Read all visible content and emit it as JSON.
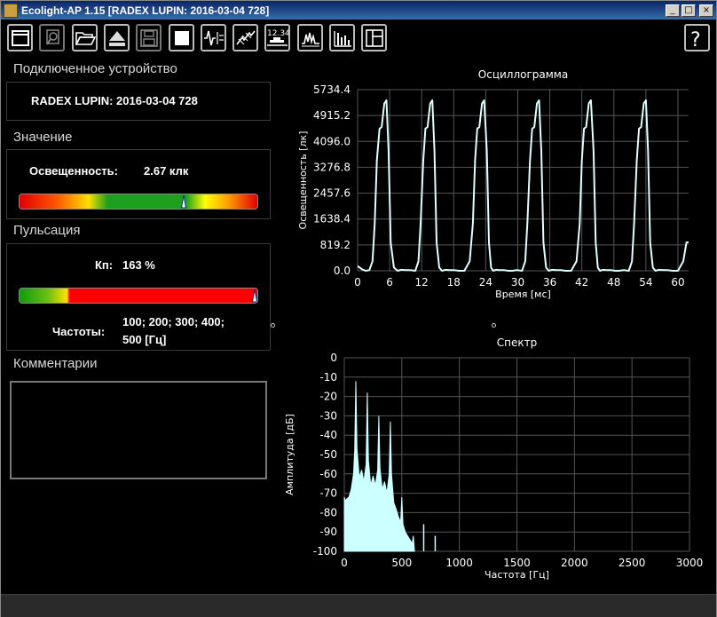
{
  "window": {
    "title": "Ecolight-AP 1.15 [RADEX LUPIN: 2016-03-04 728]",
    "controls": {
      "minimize": "_",
      "maximize": "□",
      "close": "×"
    }
  },
  "toolbar": {
    "buttons": [
      {
        "icon": "window-icon",
        "enabled": true
      },
      {
        "icon": "magnifier-icon",
        "enabled": false
      },
      {
        "icon": "folder-open-icon",
        "enabled": true
      },
      {
        "icon": "eject-icon",
        "enabled": true
      },
      {
        "icon": "save-icon",
        "enabled": false
      },
      {
        "icon": "stop-icon",
        "enabled": true
      },
      {
        "icon": "waveform-icon",
        "enabled": true
      },
      {
        "icon": "zigzag-ruler-icon",
        "enabled": true
      },
      {
        "icon": "numeric-display-icon",
        "text": "12.34",
        "enabled": true
      },
      {
        "icon": "oscilloscope-icon",
        "enabled": true
      },
      {
        "icon": "spectrum-bars-icon",
        "enabled": true
      },
      {
        "icon": "layout-panels-icon",
        "enabled": true
      },
      {
        "icon": "help-icon",
        "text": "?",
        "enabled": true
      }
    ]
  },
  "device": {
    "section_title": "Подключенное устройство",
    "name": "RADEX LUPIN:  2016-03-04 728"
  },
  "value": {
    "section_title": "Значение",
    "label": "Освещенность:",
    "reading": "2.67 клк",
    "marker_fraction": 0.69
  },
  "pulsation": {
    "section_title": "Пульсация",
    "kp_label": "Кп:",
    "kp_value": "163 %",
    "marker_fraction": 1.0,
    "freq_label": "Частоты:",
    "freq_line1": "100; 200; 300; 400;",
    "freq_line2": "500 [Гц]"
  },
  "comments": {
    "section_title": "Комментарии",
    "text": ""
  },
  "chart_data": [
    {
      "type": "line",
      "title": "Осциллограмма",
      "xlabel": "Время [мс]",
      "ylabel": "Освещенность [лк]",
      "xlim": [
        0,
        62
      ],
      "ylim": [
        0,
        5734.4
      ],
      "xticks": [
        "0",
        "6",
        "12",
        "18",
        "24",
        "30",
        "36",
        "42",
        "48",
        "54",
        "60"
      ],
      "yticks": [
        "0.0",
        "819.2",
        "1638.4",
        "2457.6",
        "3276.8",
        "4096.0",
        "4915.2",
        "5734.4"
      ],
      "grid": true,
      "color": "#e0ffff",
      "series": [
        {
          "x": [
            0,
            0.8,
            1.5,
            2.2,
            2.8,
            3.2,
            3.6,
            4.1,
            4.5,
            5.0,
            5.4,
            5.8,
            6.2,
            6.8,
            7.5,
            8.2,
            9.0,
            9.8,
            10.8,
            11.4,
            11.8,
            12.3,
            12.7,
            13.1,
            13.6,
            14.0,
            14.4,
            14.8,
            15.3,
            15.8,
            16.4,
            17.2,
            18.0,
            19.0,
            20.0,
            21.0,
            21.6,
            22.0,
            22.4,
            22.8,
            23.3,
            23.7,
            24.2,
            24.6,
            25.0,
            25.4,
            25.9,
            26.6,
            27.4,
            28.2,
            29.0,
            29.8,
            30.8,
            31.4,
            31.8,
            32.3,
            32.7,
            33.1,
            33.6,
            34.0,
            34.4,
            34.8,
            35.3,
            35.8,
            36.4,
            37.2,
            38.0,
            39.0,
            40.0,
            41.0,
            41.6,
            42.0,
            42.4,
            42.8,
            43.3,
            43.7,
            44.2,
            44.6,
            45.0,
            45.4,
            45.9,
            46.6,
            47.4,
            48.2,
            49.0,
            49.8,
            50.8,
            51.4,
            51.8,
            52.3,
            52.7,
            53.1,
            53.6,
            54.0,
            54.4,
            54.8,
            55.3,
            55.8,
            56.4,
            57.2,
            58.0,
            59.0,
            60.0,
            61.0,
            61.6,
            62.0
          ],
          "y": [
            150,
            50,
            0,
            20,
            300,
            1500,
            3500,
            4500,
            4550,
            5300,
            5400,
            3800,
            900,
            100,
            0,
            30,
            20,
            20,
            0,
            300,
            1500,
            3500,
            4500,
            4550,
            5300,
            5400,
            3800,
            900,
            100,
            0,
            30,
            20,
            20,
            0,
            0,
            300,
            1500,
            3500,
            4500,
            4550,
            5300,
            5400,
            3800,
            900,
            100,
            0,
            30,
            20,
            20,
            0,
            0,
            20,
            0,
            300,
            1500,
            3500,
            4500,
            4550,
            5300,
            5400,
            3800,
            900,
            100,
            0,
            30,
            20,
            20,
            0,
            0,
            300,
            1500,
            3500,
            4500,
            4550,
            5300,
            5400,
            3800,
            900,
            100,
            0,
            30,
            20,
            20,
            0,
            0,
            20,
            0,
            300,
            1500,
            3500,
            4500,
            4550,
            5300,
            5400,
            3800,
            900,
            100,
            0,
            30,
            20,
            20,
            0,
            0,
            300,
            900,
            900
          ]
        }
      ]
    },
    {
      "type": "area",
      "title": "Спектр",
      "xlabel": "Частота [Гц]",
      "ylabel": "Амплитуда [дБ]",
      "xlim": [
        0,
        3000
      ],
      "ylim": [
        -100,
        0
      ],
      "xticks": [
        "0",
        "500",
        "1000",
        "1500",
        "2000",
        "2500",
        "3000"
      ],
      "yticks": [
        "0",
        "-10",
        "-20",
        "-30",
        "-40",
        "-50",
        "-60",
        "-70",
        "-80",
        "-90",
        "-100"
      ],
      "grid": true,
      "color": "#ccffff",
      "series": [
        {
          "x": [
            0,
            10,
            20,
            40,
            60,
            80,
            90,
            100,
            110,
            130,
            150,
            170,
            190,
            200,
            210,
            230,
            250,
            270,
            290,
            300,
            310,
            330,
            350,
            370,
            390,
            400,
            410,
            430,
            450,
            470,
            490,
            500,
            510,
            530,
            550,
            570,
            590,
            600,
            610
          ],
          "y": [
            -72,
            -74,
            -73,
            -72,
            -68,
            -60,
            -48,
            -12,
            -47,
            -62,
            -58,
            -64,
            -55,
            -18,
            -53,
            -66,
            -61,
            -66,
            -58,
            -30,
            -57,
            -68,
            -64,
            -70,
            -60,
            -33,
            -60,
            -75,
            -78,
            -82,
            -85,
            -72,
            -86,
            -90,
            -92,
            -94,
            -96,
            -92,
            -100
          ]
        }
      ],
      "lines": [
        {
          "x": 690,
          "y": -86
        },
        {
          "x": 790,
          "y": -92
        }
      ]
    }
  ]
}
